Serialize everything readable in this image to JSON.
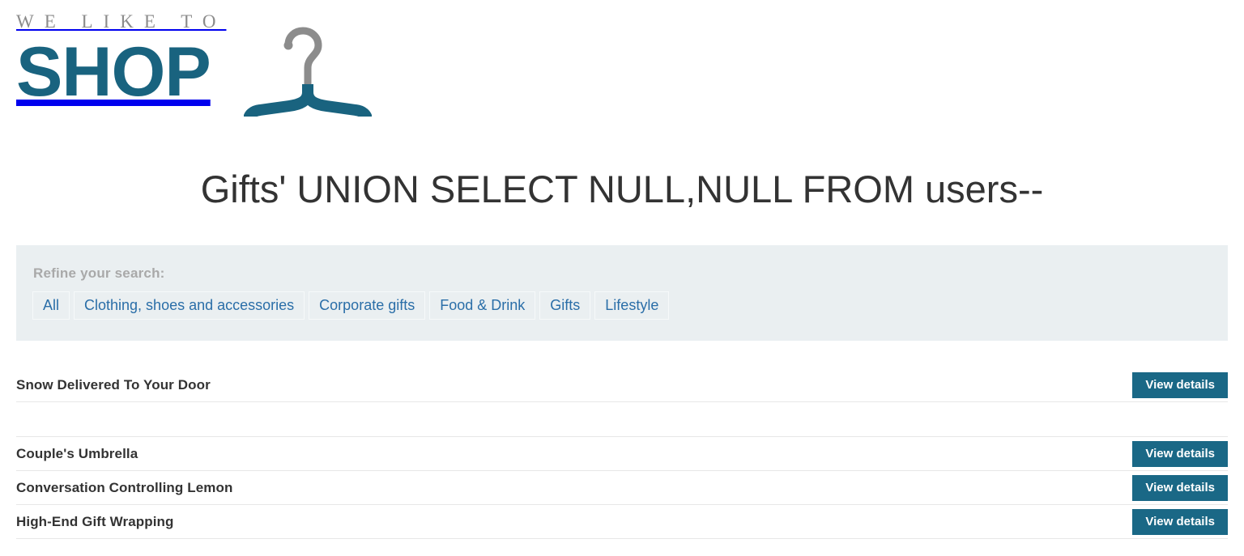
{
  "header": {
    "logo": {
      "tagline": "WE LIKE TO",
      "name": "SHOP",
      "icon": "clothes-hanger-icon",
      "hook_color": "#8c8c8c",
      "body_color": "#19637f"
    }
  },
  "main": {
    "title": "Gifts' UNION SELECT NULL,NULL FROM users--"
  },
  "refine": {
    "label": "Refine your search:",
    "filters": [
      {
        "label": "All"
      },
      {
        "label": "Clothing, shoes and accessories"
      },
      {
        "label": "Corporate gifts"
      },
      {
        "label": "Food & Drink"
      },
      {
        "label": "Gifts"
      },
      {
        "label": "Lifestyle"
      }
    ]
  },
  "products": {
    "button_label": "View details",
    "rows": [
      {
        "name": "Snow Delivered To Your Door",
        "has_button": true
      },
      {
        "name": "",
        "has_button": false
      },
      {
        "name": "Couple's Umbrella",
        "has_button": true
      },
      {
        "name": "Conversation Controlling Lemon",
        "has_button": true
      },
      {
        "name": "High-End Gift Wrapping",
        "has_button": true
      }
    ]
  },
  "colors": {
    "brand": "#19637f",
    "button": "#1a6886",
    "link": "#2a6ea8",
    "panel_bg": "#eaeff1",
    "muted_text": "#a9a9a9",
    "body_text": "#333333"
  }
}
